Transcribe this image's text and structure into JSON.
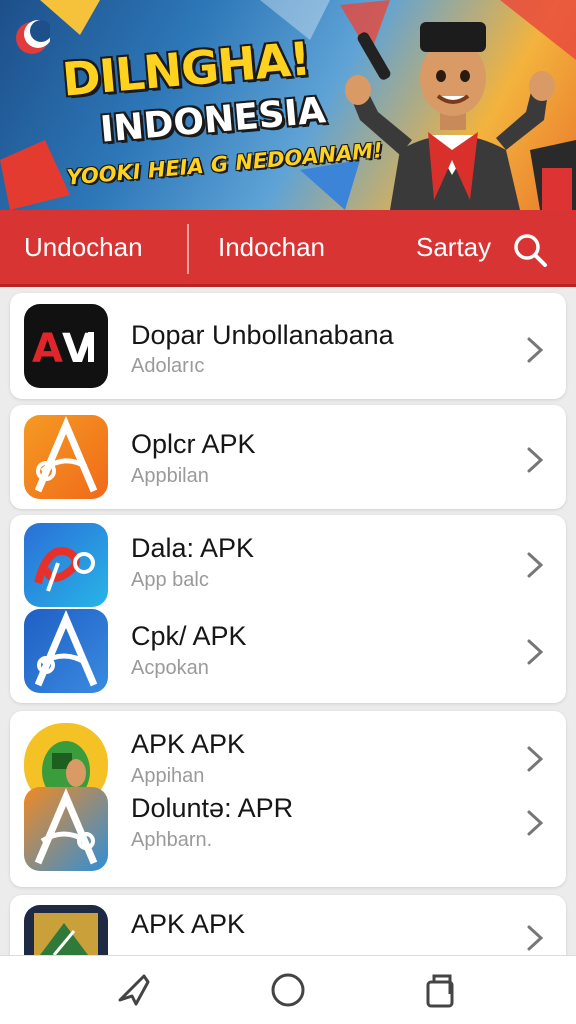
{
  "banner": {
    "line1": "DILNGHA!",
    "line2": "INDONESIA",
    "line3": "YOOKI HEIA G NEDOANAM!",
    "moon_icon": "crescent-moon-icon"
  },
  "nav": {
    "tab1": "Undochan",
    "tab2": "Indochan",
    "tab3": "Sartay",
    "search_icon": "search-icon",
    "bar_color": "#d93434"
  },
  "apps": [
    {
      "name": "Dopar Unbollanabana",
      "sub": "Adolarıc",
      "icon": "av-logo-icon"
    },
    {
      "name": "Oplcr APK",
      "sub": "Appbilan",
      "icon": "letter-a-orange-icon"
    },
    {
      "name": "Dala: APK",
      "sub": "App balc",
      "icon": "blue-swirl-icon"
    },
    {
      "name": "Cpk/ APK",
      "sub": "Acpokan",
      "icon": "letter-a-blue-icon"
    },
    {
      "name": "APK APK",
      "sub": "Appihan",
      "icon": "green-character-icon"
    },
    {
      "name": "Doluntə: APR",
      "sub": "Aphbarn.",
      "icon": "letter-a-multicolor-icon"
    },
    {
      "name": "APK APK",
      "sub": "",
      "icon": "dark-card-icon"
    }
  ],
  "bottom_nav": {
    "back_icon": "back-triangle-icon",
    "home_icon": "home-circle-icon",
    "recents_icon": "recents-square-icon"
  }
}
